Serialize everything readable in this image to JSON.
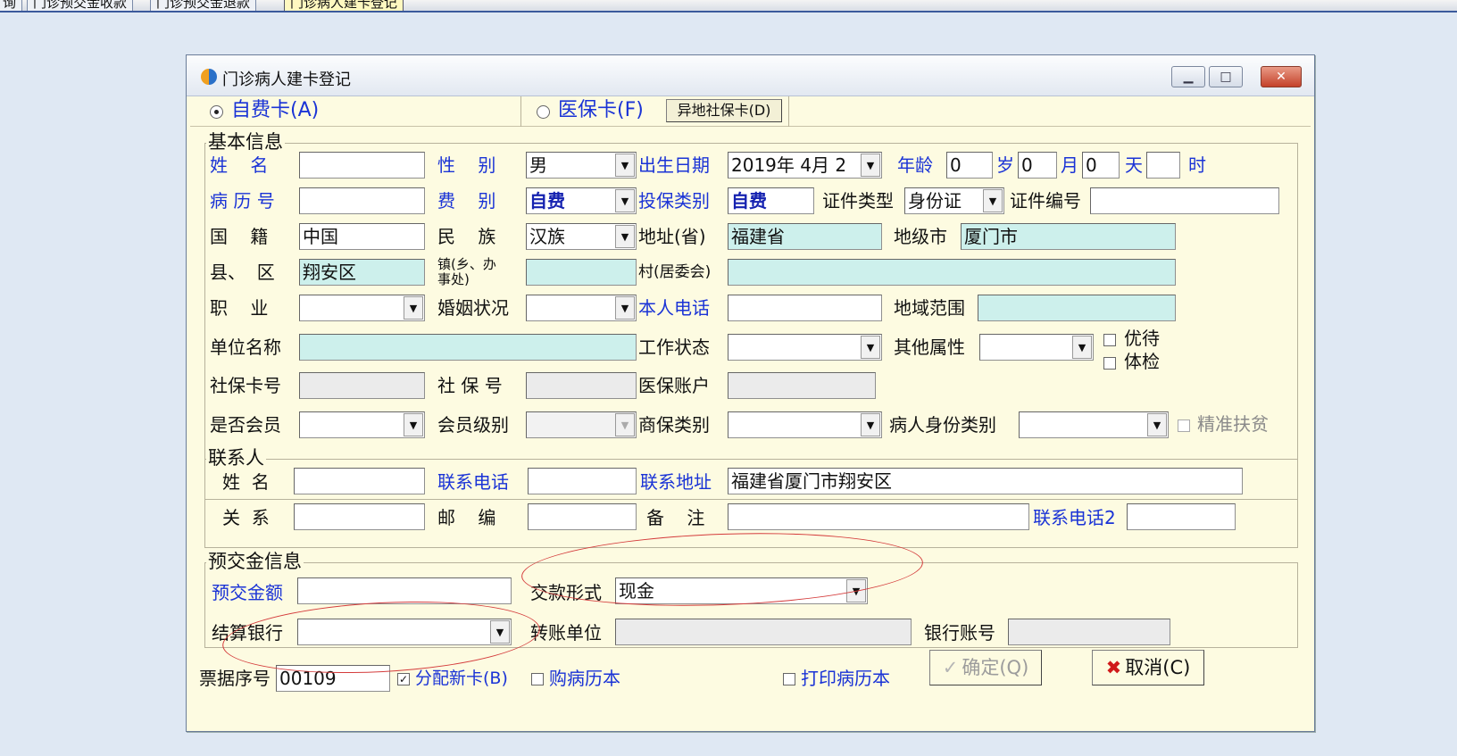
{
  "tabs": [
    "询",
    "门诊预交金收款",
    "门诊预交金退款",
    "门诊病人建卡登记"
  ],
  "window": {
    "title": "门诊病人建卡登记"
  },
  "card_type": {
    "self_pay": "自费卡(A)",
    "insurance": "医保卡(F)",
    "remote_card_button": "异地社保卡(D)"
  },
  "basic": {
    "legend": "基本信息",
    "name_label": "姓    名",
    "name_value": "",
    "gender_label": "性    别",
    "gender_value": "男",
    "birth_label": "出生日期",
    "birth_value": "2019年 4月 2",
    "age_label": "年龄",
    "age_years": "0",
    "years_unit": "岁",
    "age_months": "0",
    "months_unit": "月",
    "age_days": "0",
    "days_unit": "天",
    "age_hours": "",
    "hours_unit": "时",
    "record_no_label": "病 历 号",
    "record_no_value": "",
    "fee_label": "费    别",
    "fee_value": "自费",
    "insure_type_label": "投保类别",
    "insure_type_value": "自费",
    "id_type_label": "证件类型",
    "id_type_value": "身份证",
    "id_no_label": "证件编号",
    "id_no_value": "",
    "nationality_label": "国    籍",
    "nationality_value": "中国",
    "ethnic_label": "民    族",
    "ethnic_value": "汉族",
    "province_label": "地址(省)",
    "province_value": "福建省",
    "city_label": "地级市",
    "city_value": "厦门市",
    "county_label": "县、  区",
    "county_value": "翔安区",
    "town_label_1": "镇(乡、办",
    "town_label_2": "事处)",
    "town_value": "",
    "village_label": "村(居委会)",
    "village_value": "",
    "job_label": "职    业",
    "job_value": "",
    "marital_label": "婚姻状况",
    "marital_value": "",
    "phone_label": "本人电话",
    "phone_value": "",
    "region_label": "地域范围",
    "region_value": "",
    "employer_label": "单位名称",
    "employer_value": "",
    "work_status_label": "工作状态",
    "work_status_value": "",
    "other_attr_label": "其他属性",
    "other_attr_value": "",
    "vip_label": "优待",
    "checkup_label": "体检",
    "social_card_label": "社保卡号",
    "social_card_value": "",
    "social_no_label": "社 保 号",
    "social_no_value": "",
    "medical_account_label": "医保账户",
    "medical_account_value": "",
    "member_label": "是否会员",
    "member_value": "",
    "member_level_label": "会员级别",
    "member_level_value": "",
    "commercial_label": "商保类别",
    "commercial_value": "",
    "identity_type_label": "病人身份类别",
    "identity_type_value": "",
    "poverty_label": "精准扶贫"
  },
  "contact": {
    "legend": "联系人",
    "name_label": "姓  名",
    "name_value": "",
    "phone_label": "联系电话",
    "phone_value": "",
    "address_label": "联系地址",
    "address_value": "福建省厦门市翔安区",
    "relation_label": "关  系",
    "relation_value": "",
    "postcode_label": "邮    编",
    "postcode_value": "",
    "remark_label": "备    注",
    "remark_value": "",
    "phone2_label": "联系电话2",
    "phone2_value": ""
  },
  "deposit": {
    "legend": "预交金信息",
    "amount_label": "预交金额",
    "amount_value": "",
    "payment_label": "交款形式",
    "payment_value": "现金",
    "bank_label": "结算银行",
    "bank_value": "",
    "transfer_label": "转账单位",
    "transfer_value": "",
    "account_label": "银行账号",
    "account_value": ""
  },
  "footer": {
    "receipt_label": "票据序号",
    "receipt_value": "00109",
    "new_card_label": "分配新卡(B)",
    "buy_record_label": "购病历本",
    "print_record_label": "打印病历本",
    "ok_label": "确定(Q)",
    "cancel_label": "取消(C)"
  },
  "icons": {
    "ok": "check-icon",
    "cancel": "x-icon",
    "dropdown": "triangle-down-icon"
  },
  "colors": {
    "required_label": "#1a33d6",
    "cyan_field": "#cdf0ec",
    "dialog_bg": "#fdfbe1",
    "annotation": "#d43b3b"
  }
}
